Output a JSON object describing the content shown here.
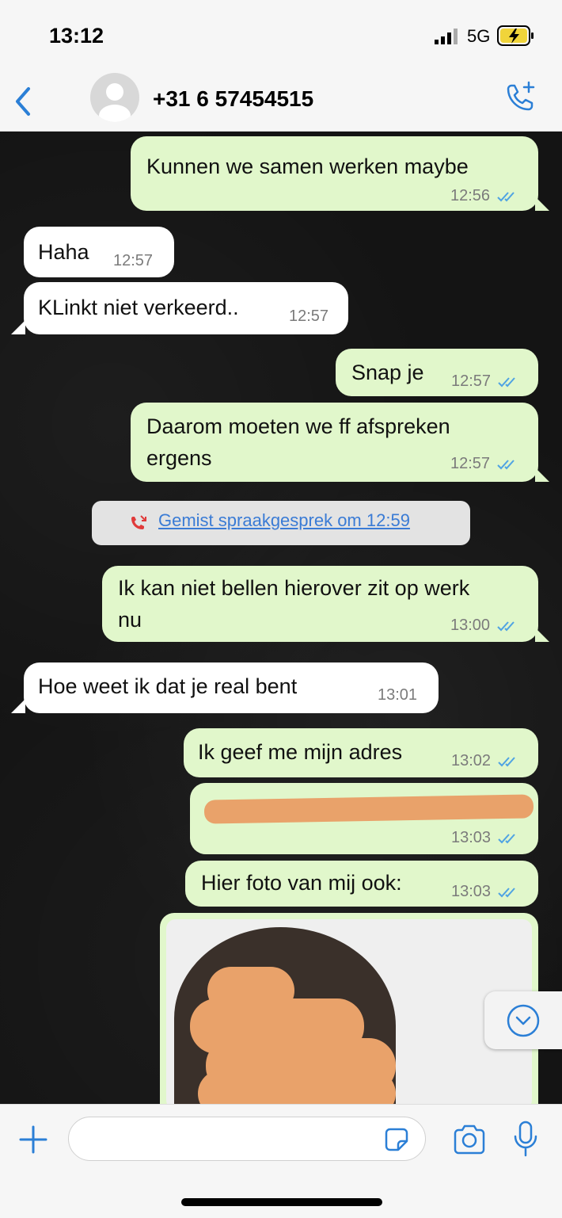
{
  "status": {
    "time": "13:12",
    "network": "5G"
  },
  "header": {
    "contact": "+31 6 57454515"
  },
  "messages": [
    {
      "text": "Kunnen we samen werken maybe",
      "time": "12:56"
    },
    {
      "text": "Haha",
      "time": "12:57"
    },
    {
      "text": "KLinkt niet verkeerd..",
      "time": "12:57"
    },
    {
      "text": "Snap je",
      "time": "12:57"
    },
    {
      "text_line1": "Daarom moeten we ff afspreken",
      "text_line2": "ergens",
      "time": "12:57"
    },
    {
      "text_line1": "Ik kan niet bellen hierover zit op werk",
      "text_line2": "nu",
      "time": "13:00"
    },
    {
      "text": "Hoe weet ik dat je real bent",
      "time": "13:01"
    },
    {
      "text": "Ik geef me mijn adres",
      "time": "13:02"
    },
    {
      "text": "",
      "time": "13:03"
    },
    {
      "text": "Hier foto van mij ook:",
      "time": "13:03"
    }
  ],
  "missed_call": {
    "label": "Gemist spraakgesprek om 12:59"
  },
  "colors": {
    "outgoing": "#e1f7cb",
    "incoming": "#ffffff",
    "accent": "#3a7bd5",
    "tick": "#4fa3e3",
    "redaction": "#e9a26a"
  },
  "icons": [
    "back-chevron-icon",
    "avatar-icon",
    "add-call-icon",
    "double-check-icon",
    "missed-call-icon",
    "scroll-down-icon",
    "plus-icon",
    "sticker-icon",
    "camera-icon",
    "microphone-icon"
  ]
}
